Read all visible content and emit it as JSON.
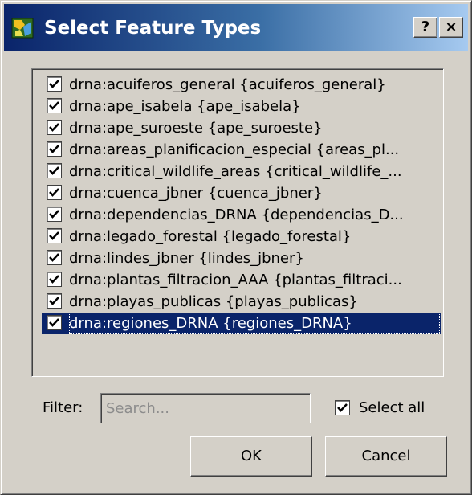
{
  "window": {
    "title": "Select Feature Types",
    "help_label": "?",
    "close_label": "×"
  },
  "feature_types": [
    {
      "label": "drna:acuiferos_general  {acuiferos_general}",
      "checked": true
    },
    {
      "label": "drna:ape_isabela  {ape_isabela}",
      "checked": true
    },
    {
      "label": "drna:ape_suroeste  {ape_suroeste}",
      "checked": true
    },
    {
      "label": "drna:areas_planificacion_especial  {areas_pl...",
      "checked": true
    },
    {
      "label": "drna:critical_wildlife_areas  {critical_wildlife_...",
      "checked": true
    },
    {
      "label": "drna:cuenca_jbner  {cuenca_jbner}",
      "checked": true
    },
    {
      "label": "drna:dependencias_DRNA  {dependencias_D...",
      "checked": true
    },
    {
      "label": "drna:legado_forestal  {legado_forestal}",
      "checked": true
    },
    {
      "label": "drna:lindes_jbner  {lindes_jbner}",
      "checked": true
    },
    {
      "label": "drna:plantas_filtracion_AAA  {plantas_filtraci...",
      "checked": true
    },
    {
      "label": "drna:playas_publicas  {playas_publicas}",
      "checked": true
    },
    {
      "label": "drna:regiones_DRNA  {regiones_DRNA}",
      "checked": true,
      "selected": true
    }
  ],
  "filter": {
    "label": "Filter:",
    "placeholder": "Search...",
    "value": ""
  },
  "select_all": {
    "label": "Select all",
    "checked": true
  },
  "buttons": {
    "ok": "OK",
    "cancel": "Cancel"
  },
  "colors": {
    "selection": "#0a246a",
    "face": "#d4d0c8"
  }
}
